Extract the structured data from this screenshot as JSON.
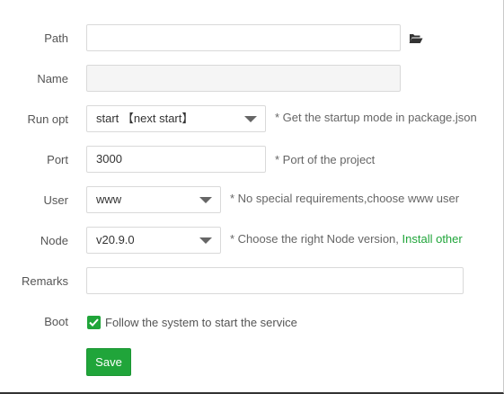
{
  "form": {
    "path": {
      "label": "Path",
      "value": "",
      "icon": "folder-open-icon"
    },
    "name": {
      "label": "Name",
      "value": ""
    },
    "run_opt": {
      "label": "Run opt",
      "value": "start 【next start】",
      "hint": "* Get the startup mode in package.json"
    },
    "port": {
      "label": "Port",
      "value": "3000",
      "hint": "* Port of the project"
    },
    "user": {
      "label": "User",
      "value": "www",
      "hint": "* No special requirements,choose www user"
    },
    "node": {
      "label": "Node",
      "value": "v20.9.0",
      "hint": "* Choose the right Node version,",
      "link": "Install other"
    },
    "remarks": {
      "label": "Remarks",
      "value": ""
    },
    "boot": {
      "label": "Boot",
      "checked": true,
      "checkbox_label": "Follow the system to start the service"
    },
    "save_label": "Save"
  },
  "colors": {
    "accent": "#20a53a",
    "border": "#d9d9d9",
    "disabled_bg": "#f5f5f5"
  }
}
